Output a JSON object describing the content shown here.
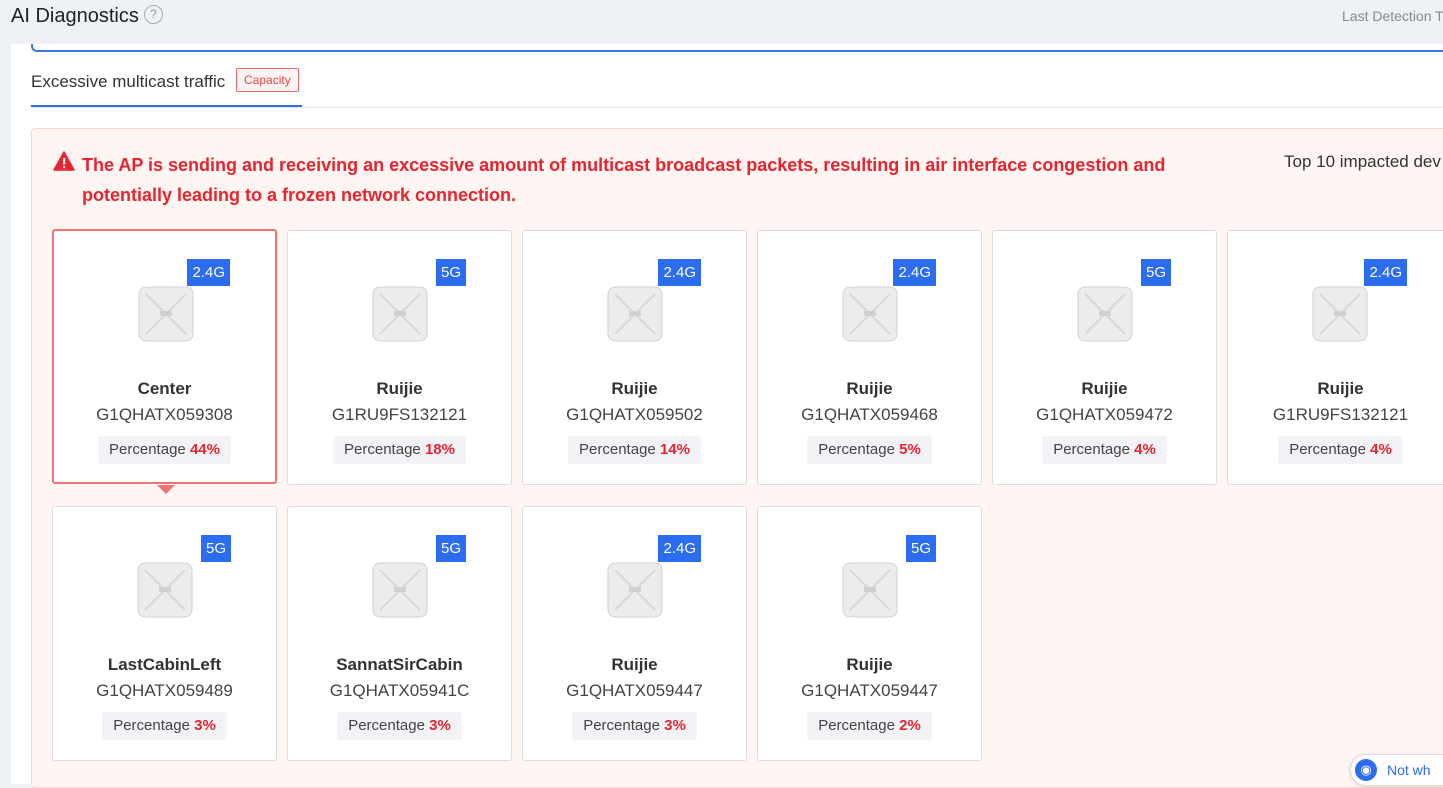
{
  "header": {
    "title": "AI Diagnostics",
    "help_icon": "?",
    "last_detection_label": "Last Detection T"
  },
  "tab": {
    "label": "Excessive multicast traffic",
    "badge": "Capacity"
  },
  "alert": {
    "icon": "warning-icon",
    "message": "The AP is sending and receiving an excessive amount of multicast broadcast packets, resulting in air interface congestion and potentially leading to a frozen network connection.",
    "top_label": "Top 10 impacted dev"
  },
  "colors": {
    "accent": "#2b6cf0",
    "alert_red": "#e8242e",
    "selected_border": "#f07373"
  },
  "percentage_label": "Percentage",
  "devices": [
    {
      "name": "Center",
      "sn": "G1QHATX059308",
      "band": "2.4G",
      "percent": "44%",
      "selected": true
    },
    {
      "name": "Ruijie",
      "sn": "G1RU9FS132121",
      "band": "5G",
      "percent": "18%"
    },
    {
      "name": "Ruijie",
      "sn": "G1QHATX059502",
      "band": "2.4G",
      "percent": "14%"
    },
    {
      "name": "Ruijie",
      "sn": "G1QHATX059468",
      "band": "2.4G",
      "percent": "5%"
    },
    {
      "name": "Ruijie",
      "sn": "G1QHATX059472",
      "band": "5G",
      "percent": "4%"
    },
    {
      "name": "Ruijie",
      "sn": "G1RU9FS132121",
      "band": "2.4G",
      "percent": "4%"
    },
    {
      "name": "LastCabinLeft",
      "sn": "G1QHATX059489",
      "band": "5G",
      "percent": "3%"
    },
    {
      "name": "SannatSirCabin",
      "sn": "G1QHATX05941C",
      "band": "5G",
      "percent": "3%"
    },
    {
      "name": "Ruijie",
      "sn": "G1QHATX059447",
      "band": "2.4G",
      "percent": "3%"
    },
    {
      "name": "Ruijie",
      "sn": "G1QHATX059447",
      "band": "5G",
      "percent": "2%"
    }
  ],
  "feedback": {
    "label": "Not wh"
  }
}
